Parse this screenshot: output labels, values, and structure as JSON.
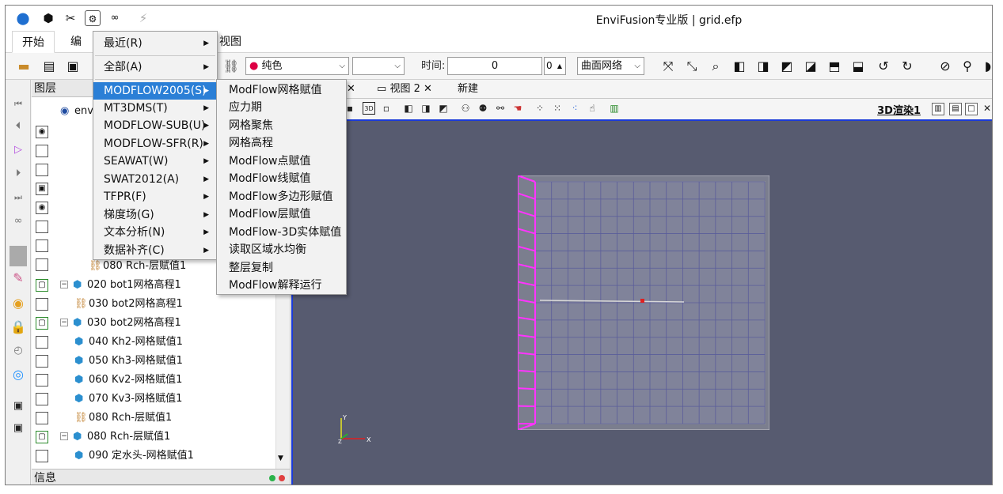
{
  "app": {
    "title": "EnviFusion专业版 | grid.efp"
  },
  "ribbon_tabs": [
    "开始",
    "编",
    "视图"
  ],
  "toolbar": {
    "color_mode": "纯色",
    "color_mode_icon": "palette-icon",
    "blank_select": "",
    "time_label": "时间:",
    "time_value": "0",
    "time_step": "0",
    "surface_type": "曲面网络"
  },
  "layer_panel": {
    "title": "图层",
    "root_label": "env",
    "items": [
      {
        "label": "080 Rch-层赋值1",
        "icon": "link-icon",
        "checked": false,
        "indent": 2
      },
      {
        "label": "020 bot1网格高程1",
        "icon": "cube-icon",
        "checked": true,
        "indent": 1
      },
      {
        "label": "030 bot2网格高程1",
        "icon": "link-icon",
        "checked": false,
        "indent": 1
      },
      {
        "label": "030 bot2网格高程1",
        "icon": "cube-icon",
        "checked": true,
        "indent": 1
      },
      {
        "label": "040 Kh2-网格赋值1",
        "icon": "cube-icon",
        "checked": false,
        "indent": 1
      },
      {
        "label": "050 Kh3-网格赋值1",
        "icon": "cube-icon",
        "checked": false,
        "indent": 1
      },
      {
        "label": "060 Kv2-网格赋值1",
        "icon": "cube-icon",
        "checked": false,
        "indent": 1
      },
      {
        "label": "070 Kv3-网格赋值1",
        "icon": "cube-icon",
        "checked": false,
        "indent": 1
      },
      {
        "label": "080 Rch-层赋值1",
        "icon": "link-icon",
        "checked": false,
        "indent": 1
      },
      {
        "label": "080 Rch-层赋值1",
        "icon": "cube-icon",
        "checked": true,
        "indent": 1
      },
      {
        "label": "090 定水头-网格赋值1",
        "icon": "cube-icon",
        "checked": false,
        "indent": 1
      }
    ],
    "info_label": "信息"
  },
  "view_tabs": [
    {
      "label": "视图 2",
      "close": "✕"
    },
    {
      "label": "新建",
      "close": ""
    }
  ],
  "view": {
    "render_label": "3D渲染1",
    "close_first": "✕"
  },
  "menu": {
    "items": [
      {
        "label": "最近(R)",
        "sub": true
      },
      {
        "label": "全部(A)",
        "sub": true
      },
      {
        "label": "MODFLOW2005(S)",
        "sub": true,
        "highlight": true
      },
      {
        "label": "MT3DMS(T)",
        "sub": true
      },
      {
        "label": "MODFLOW-SUB(U)",
        "sub": true
      },
      {
        "label": "MODFLOW-SFR(R)",
        "sub": true
      },
      {
        "label": "SEAWAT(W)",
        "sub": true
      },
      {
        "label": "SWAT2012(A)",
        "sub": true
      },
      {
        "label": "TFPR(F)",
        "sub": true
      },
      {
        "label": "梯度场(G)",
        "sub": true
      },
      {
        "label": "文本分析(N)",
        "sub": true
      },
      {
        "label": "数据补齐(C)",
        "sub": true
      }
    ],
    "submenu": [
      "ModFlow网格赋值",
      "应力期",
      "网格聚焦",
      "网格高程",
      "ModFlow点赋值",
      "ModFlow线赋值",
      "ModFlow多边形赋值",
      "ModFlow层赋值",
      "ModFlow-3D实体赋值",
      "读取区域水均衡",
      "整层复制",
      "ModFlow解释运行"
    ]
  },
  "axes": {
    "y": "Y",
    "z": "Z",
    "x": "X"
  },
  "colors": {
    "highlight": "#2b7fd6",
    "viewport": "#575b70",
    "grid_edge": "#ff33ff",
    "viewport_border": "#1a3ad8"
  }
}
